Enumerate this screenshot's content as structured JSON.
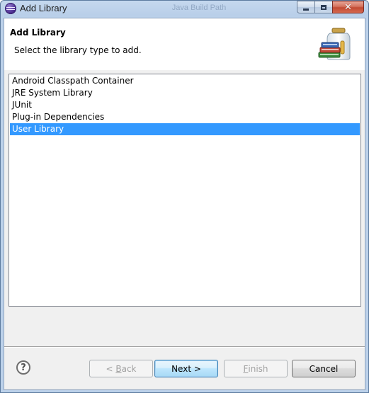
{
  "window": {
    "title": "Add Library",
    "background_title": "Java Build Path",
    "icon": "eclipse-icon"
  },
  "header": {
    "title": "Add Library",
    "description": "Select the library type to add.",
    "icon": "library-jar-icon"
  },
  "library_types": [
    {
      "label": "Android Classpath Container",
      "selected": false
    },
    {
      "label": "JRE System Library",
      "selected": false
    },
    {
      "label": "JUnit",
      "selected": false
    },
    {
      "label": "Plug-in Dependencies",
      "selected": false
    },
    {
      "label": "User Library",
      "selected": true
    }
  ],
  "buttons": {
    "help_glyph": "?",
    "back": {
      "label": "< Back",
      "prefix": "< ",
      "mnemonic": "B",
      "rest": "ack",
      "enabled": false
    },
    "next": {
      "label": "Next >",
      "enabled": true
    },
    "finish": {
      "label": "Finish",
      "mnemonic": "F",
      "rest": "inish",
      "enabled": false
    },
    "cancel": {
      "label": "Cancel",
      "enabled": true
    }
  },
  "colors": {
    "selection": "#3399ff",
    "title_bar": "#b9cfe9",
    "close_button": "#c24a34"
  }
}
